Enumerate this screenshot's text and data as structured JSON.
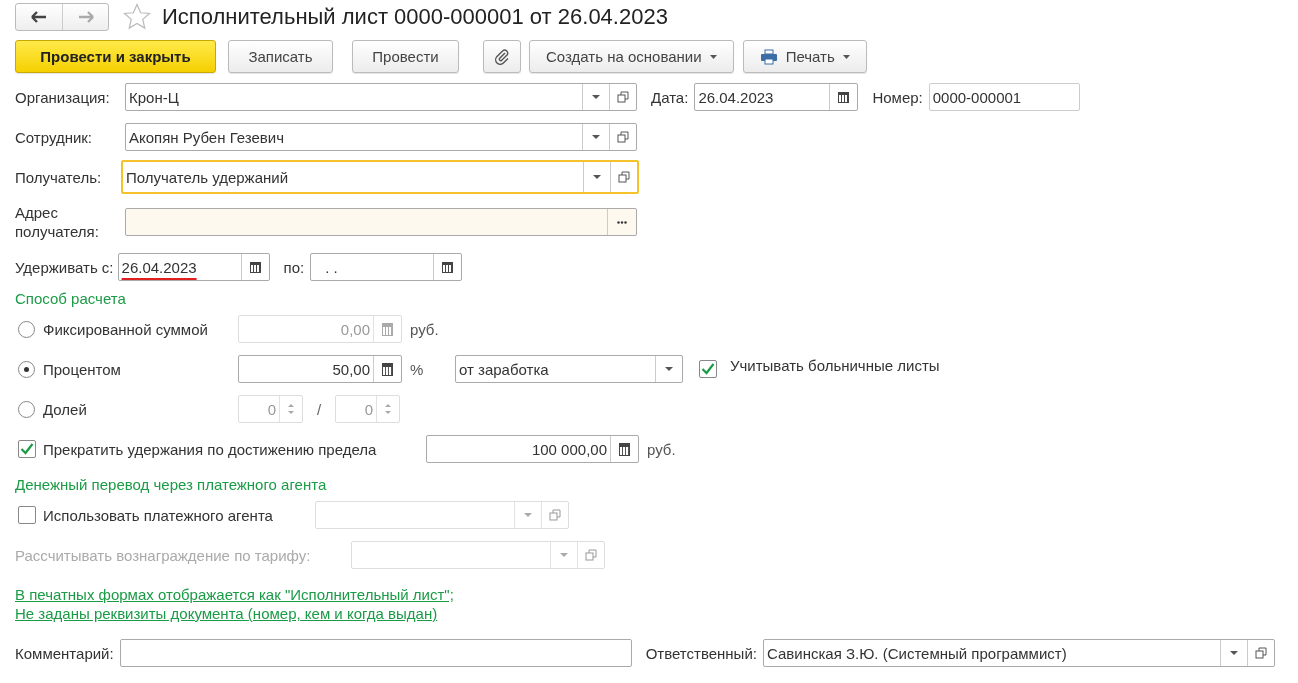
{
  "window": {
    "title": "Исполнительный лист 0000-000001 от 26.04.2023",
    "favorite": false
  },
  "toolbar": [
    {
      "kind": "primary",
      "label": "Провести и закрыть"
    },
    {
      "kind": "plain",
      "label": "Записать"
    },
    {
      "kind": "plain",
      "label": "Провести"
    },
    {
      "kind": "attach"
    },
    {
      "kind": "menu",
      "label": "Создать на основании"
    },
    {
      "kind": "print",
      "label": "Печать"
    }
  ],
  "organization": {
    "label": "Организация:",
    "value": "Крон-Ц"
  },
  "date": {
    "label": "Дата:",
    "value": "26.04.2023"
  },
  "number": {
    "label": "Номер:",
    "value": "0000-000001"
  },
  "employee": {
    "label": "Сотрудник:",
    "value": "Акопян Рубен Гезевич"
  },
  "recipient": {
    "label": "Получатель:",
    "value": "Получатель удержаний",
    "focused": true
  },
  "address": {
    "label": "Адрес получателя:"
  },
  "withhold_from": {
    "label": "Удерживать с:",
    "value": "26.04.2023"
  },
  "withhold_to": {
    "label": "по:",
    "value": ".  ."
  },
  "calc_section": "Способ расчета",
  "methods": [
    {
      "kind": "amount",
      "label": "Фиксированной суммой",
      "selected": false,
      "value": "0,00",
      "unit": "руб."
    },
    {
      "kind": "percent",
      "label": "Процентом",
      "selected": true,
      "value": "50,00",
      "unit": "%",
      "base": "от заработка",
      "sick_leave": {
        "label": "Учитывать больничные листы",
        "checked": true
      }
    },
    {
      "kind": "share",
      "label": "Долей",
      "selected": false,
      "numerator": "0",
      "separator": "/",
      "denominator": "0"
    }
  ],
  "limit": {
    "label": "Прекратить удержания по достижению предела",
    "checked": true,
    "value": "100 000,00",
    "unit": "руб."
  },
  "transfer_section": "Денежный перевод через платежного агента",
  "agent": {
    "label": "Использовать платежного агента",
    "checked": false
  },
  "tariff": {
    "label": "Рассчитывать вознаграждение по тарифу:",
    "disabled": true
  },
  "note_link": "В печатных формах отображается как \"Исполнительный лист\"; Не заданы реквизиты документа (номер, кем и когда выдан)",
  "comment": {
    "label": "Комментарий:"
  },
  "responsible": {
    "label": "Ответственный:",
    "value": "Савинская З.Ю. (Системный программист)"
  }
}
